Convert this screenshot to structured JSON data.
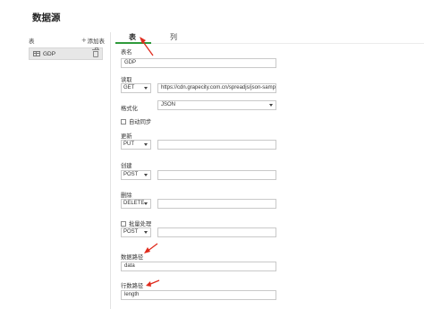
{
  "page": {
    "title": "数据源"
  },
  "sidebar": {
    "title": "表",
    "add_label": "添加表",
    "items": [
      {
        "label": "GDP"
      }
    ]
  },
  "tabs": [
    {
      "label": "表"
    },
    {
      "label": "列"
    }
  ],
  "form": {
    "table_name": {
      "label": "表名",
      "value": "GDP"
    },
    "read": {
      "label": "读取",
      "method": "GET",
      "url": "https://cdn.grapecity.com.cn/spreadjs/json-sampl"
    },
    "format": {
      "label": "格式化",
      "value": "JSON"
    },
    "auto_sync": {
      "label": "自动同步"
    },
    "update": {
      "label": "更新",
      "method": "PUT",
      "url": ""
    },
    "create": {
      "label": "创建",
      "method": "POST",
      "url": ""
    },
    "delete": {
      "label": "删除",
      "method": "DELETE",
      "url": ""
    },
    "batch": {
      "label": "批量处理",
      "method": "POST",
      "url": ""
    },
    "data_path": {
      "label": "数据路径",
      "value": "data"
    },
    "row_count_path": {
      "label": "行数路径",
      "value": "length"
    }
  },
  "colors": {
    "accent": "#2e9a3b",
    "annotation_arrow": "#e02a1c"
  }
}
